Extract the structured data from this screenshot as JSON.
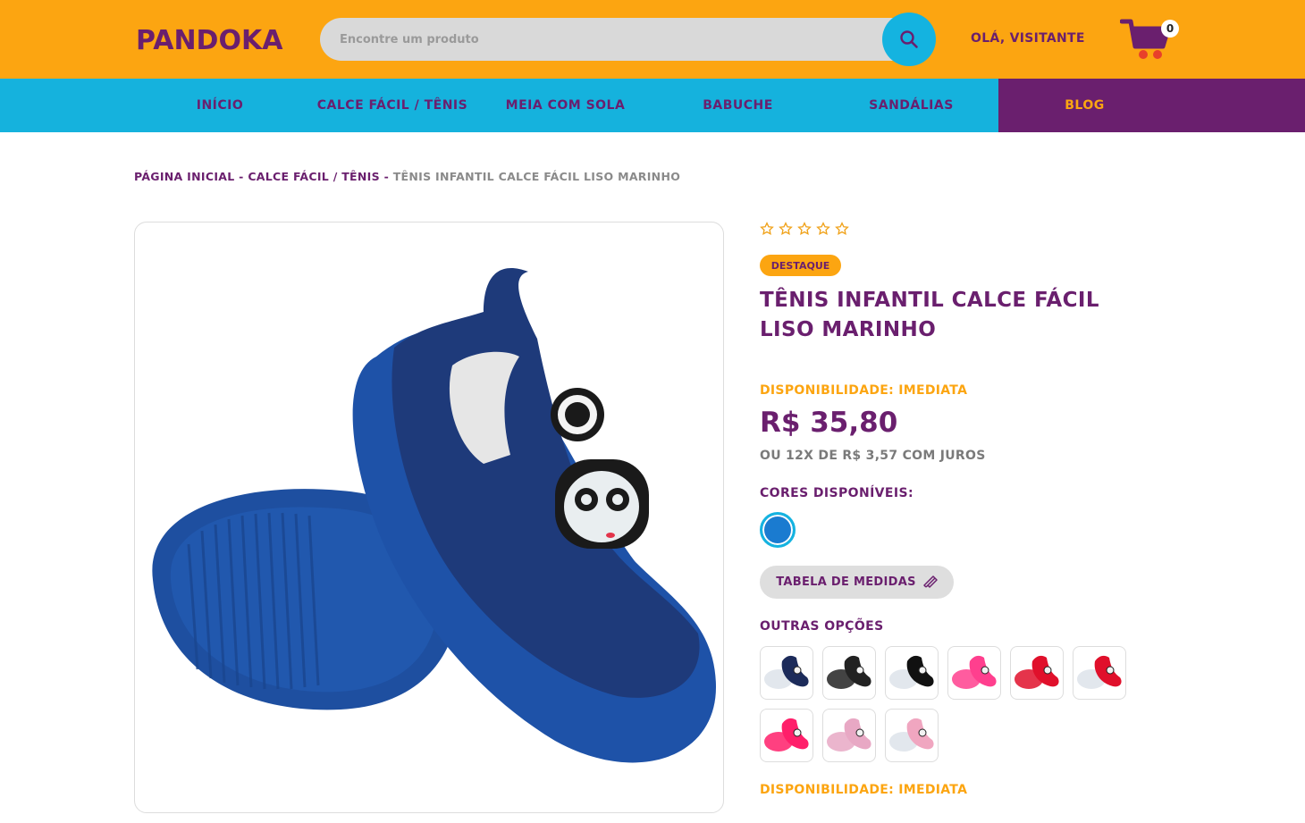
{
  "header": {
    "logo_text": "PANDOKA",
    "search_placeholder": "Encontre um produto",
    "greeting": "OLÁ, VISITANTE",
    "cart_count": "0"
  },
  "nav": {
    "items": [
      "INÍCIO",
      "CALCE FÁCIL / TÊNIS",
      "MEIA COM SOLA",
      "BABUCHE",
      "SANDÁLIAS",
      "BLOG"
    ]
  },
  "breadcrumb": {
    "home": "PÁGINA INICIAL",
    "sep1": " - ",
    "category": "CALCE FÁCIL / TÊNIS",
    "sep2": " - ",
    "current": "TÊNIS INFANTIL CALCE FÁCIL LISO MARINHO"
  },
  "product": {
    "rating": 0,
    "rating_max": 5,
    "badge": "DESTAQUE",
    "title": "TÊNIS INFANTIL CALCE FÁCIL LISO MARINHO",
    "availability": "DISPONIBILIDADE: IMEDIATA",
    "price": "R$ 35,80",
    "installments": "OU 12X DE R$ 3,57 COM JUROS",
    "colors_label": "CORES DISPONÍVEIS:",
    "selected_color": "#1a7bd0",
    "size_table_label": "TABELA DE MEDIDAS",
    "other_options_label": "OUTRAS OPÇÕES",
    "other_options": [
      {
        "color": "#1c2b5a",
        "icon": "shoe-navy"
      },
      {
        "color": "#222222",
        "icon": "shoe-black"
      },
      {
        "color": "#111111",
        "icon": "shoe-black-white-sole"
      },
      {
        "color": "#ff3f8e",
        "icon": "shoe-pink"
      },
      {
        "color": "#e0102b",
        "icon": "shoe-red"
      },
      {
        "color": "#e0102b",
        "icon": "shoe-red-white-sole"
      },
      {
        "color": "#ff1f6a",
        "icon": "shoe-hot-pink"
      },
      {
        "color": "#e8a8c4",
        "icon": "shoe-light-pink"
      },
      {
        "color": "#f0a6c0",
        "icon": "shoe-pink-white-sole"
      }
    ],
    "availability_bottom": "DISPONIBILIDADE: IMEDIATA"
  },
  "colors": {
    "orange": "#fca511",
    "purple": "#6a1f6e",
    "cyan": "#15b2dd"
  }
}
